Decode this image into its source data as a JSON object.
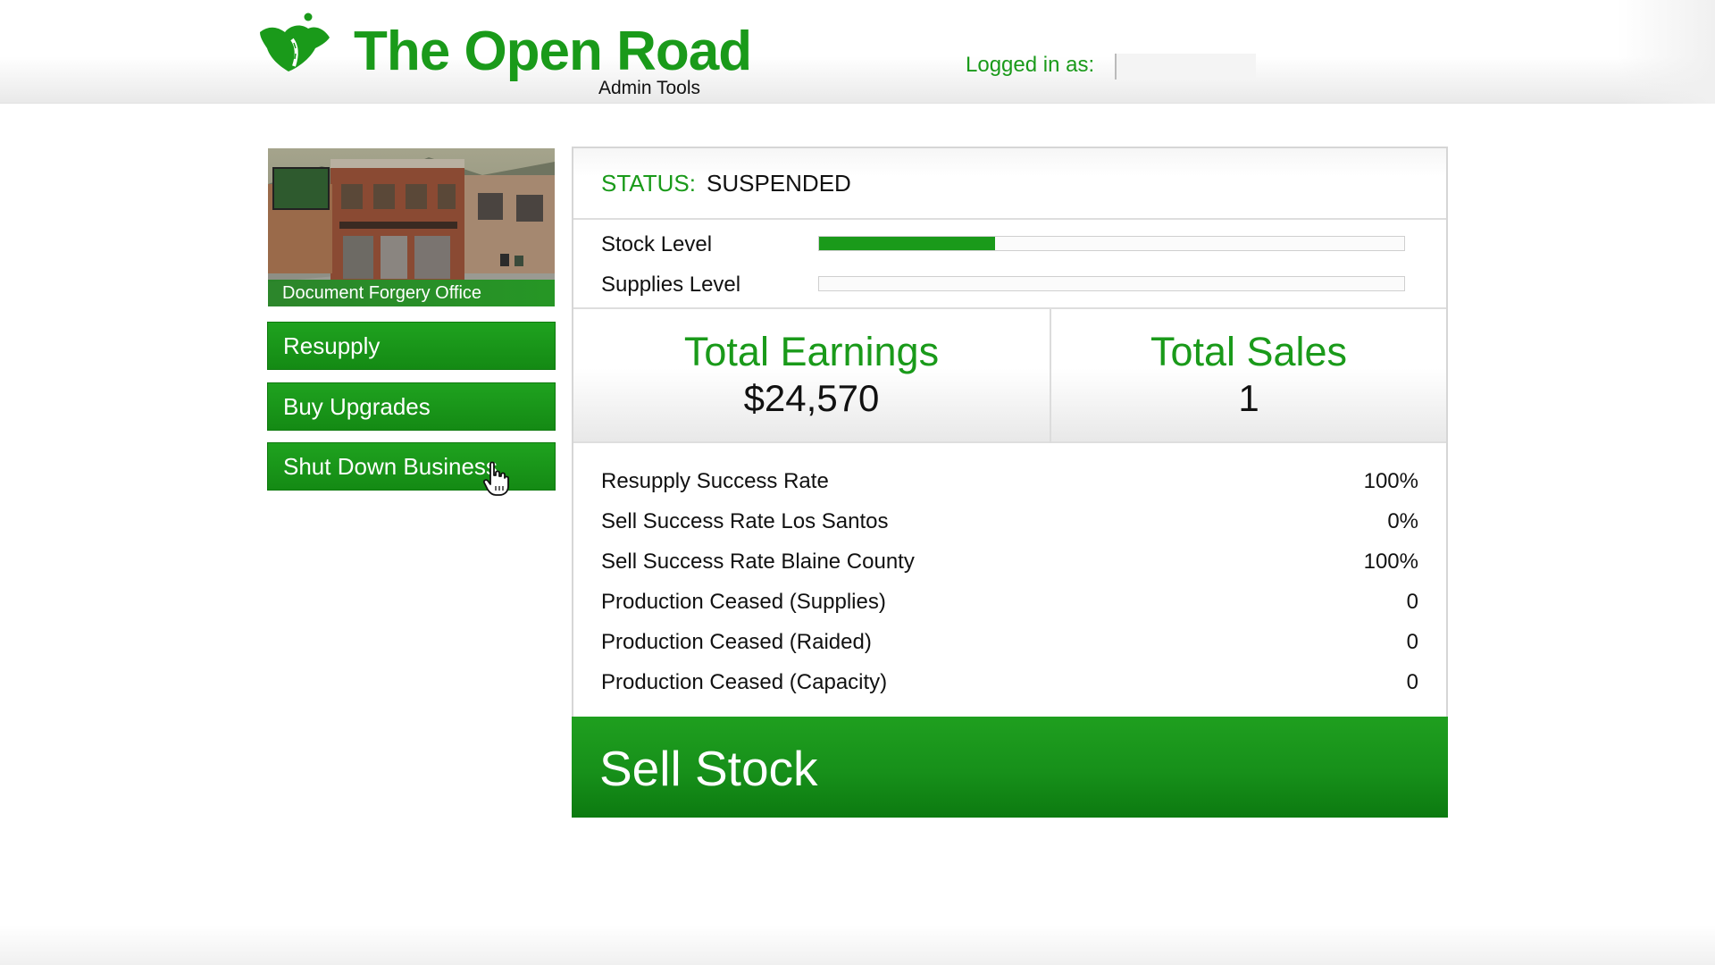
{
  "header": {
    "brand_title": "The Open Road",
    "brand_subtitle": "Admin Tools",
    "login_label": "Logged in as:",
    "login_user": "",
    "logo_icon": "open-road-logo-icon"
  },
  "business": {
    "name": "Document Forgery Office",
    "image": "business-building-photo"
  },
  "sidebar": {
    "buttons": [
      {
        "label": "Resupply"
      },
      {
        "label": "Buy Upgrades"
      },
      {
        "label": "Shut Down Business"
      }
    ]
  },
  "status": {
    "label": "STATUS:",
    "value": "SUSPENDED"
  },
  "levels": [
    {
      "label": "Stock Level",
      "fraction": 0.3
    },
    {
      "label": "Supplies Level",
      "fraction": 0.0
    }
  ],
  "totals": {
    "earnings_label": "Total Earnings",
    "earnings_value": "$24,570",
    "sales_label": "Total Sales",
    "sales_value": "1"
  },
  "metrics": [
    {
      "label": "Resupply Success Rate",
      "value": "100%"
    },
    {
      "label": "Sell Success Rate Los Santos",
      "value": "0%"
    },
    {
      "label": "Sell Success Rate Blaine County",
      "value": "100%"
    },
    {
      "label": "Production Ceased (Supplies)",
      "value": "0"
    },
    {
      "label": "Production Ceased (Raided)",
      "value": "0"
    },
    {
      "label": "Production Ceased (Capacity)",
      "value": "0"
    }
  ],
  "sell": {
    "label": "Sell Stock"
  },
  "colors": {
    "accent_green": "#1a9a1a",
    "text": "#111111"
  },
  "cursor_icon": "hand-pointer-icon"
}
